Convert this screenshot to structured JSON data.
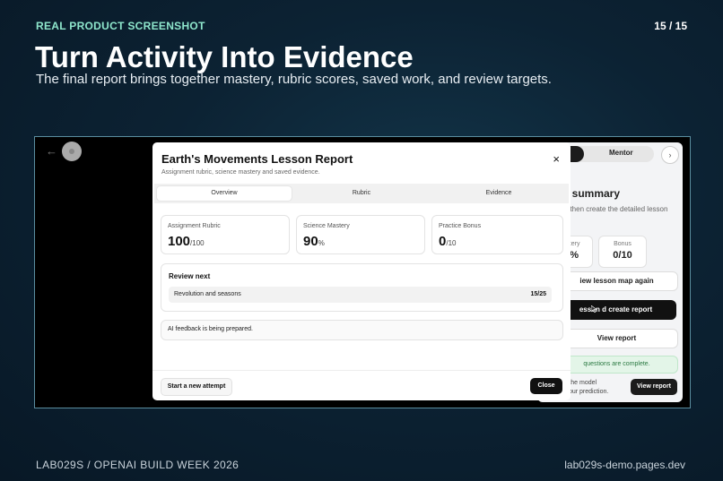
{
  "slide": {
    "kicker": "REAL PRODUCT SCREENSHOT",
    "page": "15 / 15",
    "title": "Turn Activity Into Evidence",
    "subtitle": "The final report brings together mastery, rubric scores, saved work, and review targets.",
    "footer_left": "LAB029S  /  OPENAI BUILD WEEK 2026",
    "footer_right": "lab029s-demo.pages.dev"
  },
  "app": {
    "back_icon": "arrow-left-icon",
    "mentor_label": "Mentor",
    "next_label": "›",
    "summary_title": "g summary",
    "summary_sub": "s, then create the detailed lesson",
    "stats": [
      {
        "label": "Mastery",
        "value": "90%"
      },
      {
        "label": "Bonus",
        "value": "0/10"
      }
    ],
    "btn_review_map": "iew lesson map again",
    "btn_create_report": "esson   d create report",
    "btn_view_report": "View report",
    "complete_note": "questions are complete.",
    "tip_line1": "sh the model",
    "tip_line2": "it your prediction.",
    "btn_view_report_2": "View report"
  },
  "modal": {
    "title": "Earth's Movements Lesson Report",
    "subtitle": "Assignment rubric, science mastery and saved evidence.",
    "close_icon": "×",
    "tabs": [
      {
        "label": "Overview",
        "active": true
      },
      {
        "label": "Rubric",
        "active": false
      },
      {
        "label": "Evidence",
        "active": false
      }
    ],
    "cards": [
      {
        "label": "Assignment Rubric",
        "value": "100",
        "unit": "/100"
      },
      {
        "label": "Science Mastery",
        "value": "90",
        "unit": "%"
      },
      {
        "label": "Practice Bonus",
        "value": "0",
        "unit": "/10"
      }
    ],
    "review": {
      "heading": "Review next",
      "topic": "Revolution and seasons",
      "score": "15/25"
    },
    "ai_feedback": "AI feedback is being prepared.",
    "start_new": "Start a new attempt",
    "close_label": "Close"
  }
}
